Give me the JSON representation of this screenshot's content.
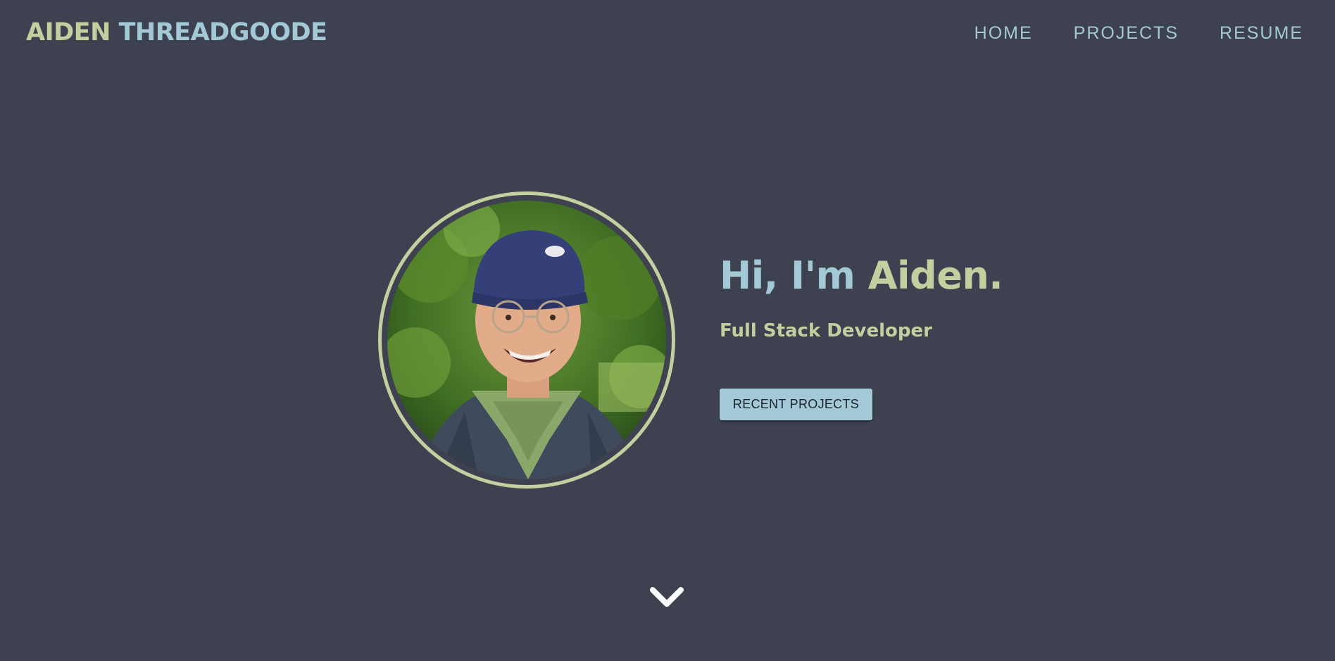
{
  "header": {
    "brand_first": "AIDEN",
    "brand_last": "THREADGOODE",
    "nav": {
      "home": "HOME",
      "projects": "PROJECTS",
      "resume": "RESUME"
    }
  },
  "hero": {
    "greeting_hi": "Hi, I'm",
    "greeting_name": "Aiden.",
    "role": "Full Stack Developer",
    "cta_label": "RECENT PROJECTS",
    "avatar_alt": "Profile photo",
    "scroll_icon": "chevron-down-icon"
  },
  "colors": {
    "background": "#3e4250",
    "accent_green": "#c3cf9e",
    "accent_blue": "#a3c9d6",
    "button_text": "#1d2230"
  }
}
